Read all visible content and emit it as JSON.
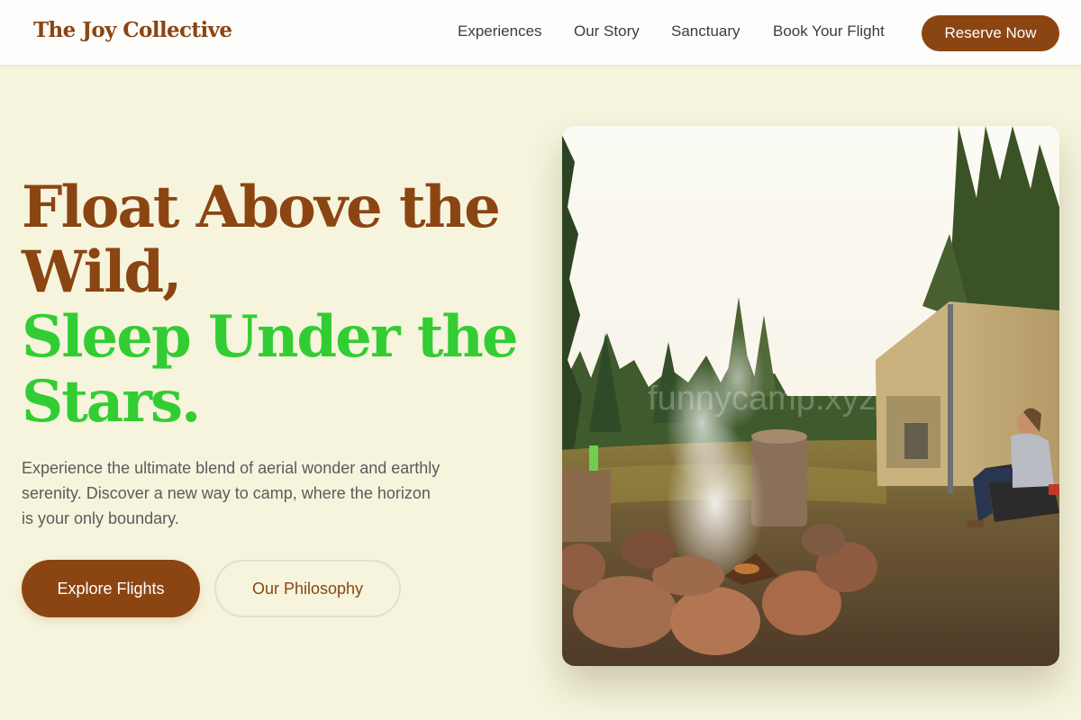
{
  "header": {
    "brand": "The Joy Collective",
    "nav": [
      "Experiences",
      "Our Story",
      "Sanctuary",
      "Book Your Flight"
    ],
    "reserve_label": "Reserve Now"
  },
  "hero": {
    "headline_line1": "Float Above the",
    "headline_line2": "Wild,",
    "headline_line3": "Sleep Under the",
    "headline_line4": "Stars.",
    "description": "Experience the ultimate blend of aerial wonder and earthly serenity. Discover a new way to camp, where the horizon is your only boundary.",
    "primary_cta": "Explore Flights",
    "secondary_cta": "Our Philosophy"
  },
  "photo": {
    "watermark": "funnycamp.xyz"
  },
  "colors": {
    "brand_brown": "#8b4513",
    "accent_green": "#32cd32",
    "page_background": "#f6f4dc"
  }
}
